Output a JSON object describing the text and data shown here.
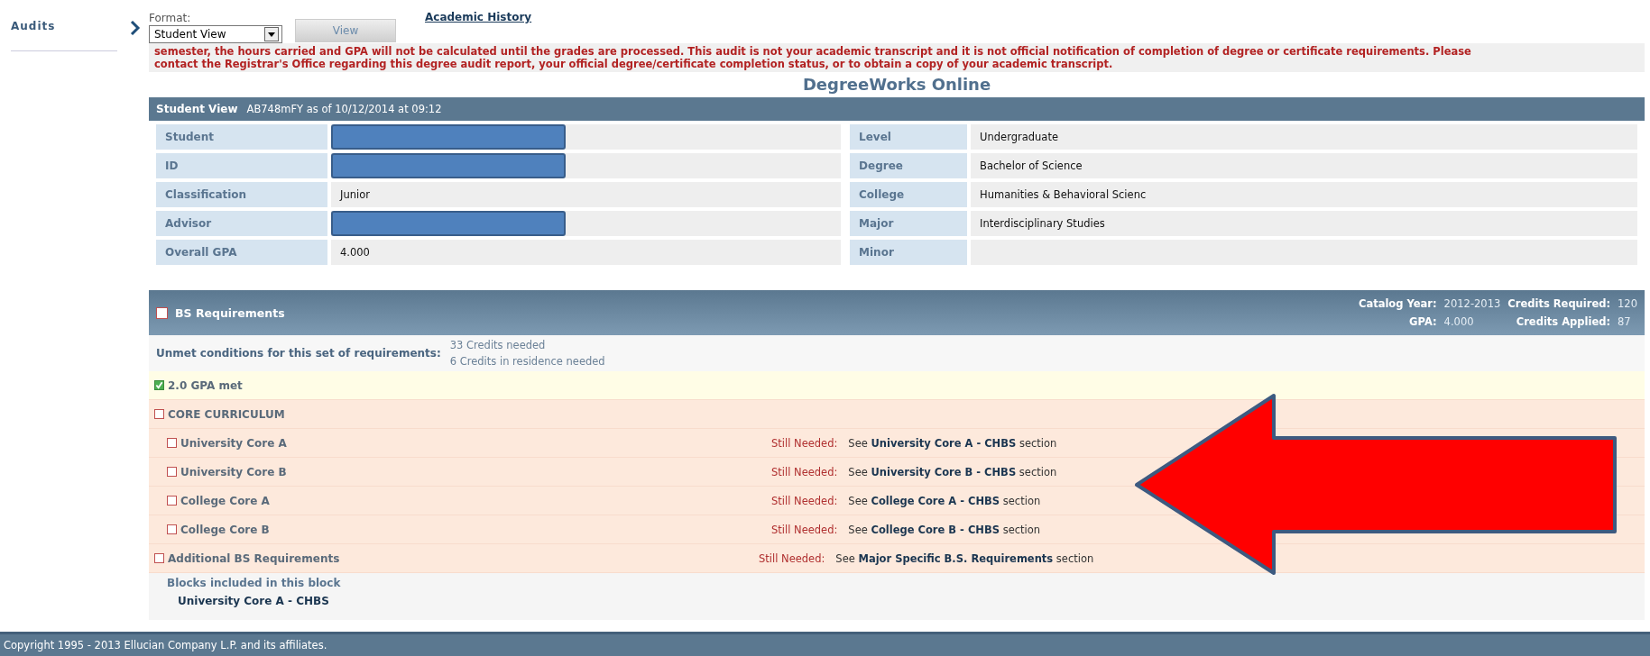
{
  "sidebar": {
    "items": [
      {
        "label": "Audits",
        "selected": true
      }
    ]
  },
  "toolbar": {
    "format_label": "Format:",
    "format_value": "Student View",
    "view_button": "View",
    "link": "Academic History"
  },
  "notice": [
    "semester, the hours carried and GPA will not be calculated until the grades are processed. This audit is not your academic transcript and it is not official notification of completion of degree or certificate requirements. Please",
    "contact the Registrar's Office regarding this degree audit report, your official degree/certificate completion status, or to obtain a copy of your academic transcript."
  ],
  "page_title": "DegreeWorks Online",
  "student_view": {
    "title": "Student View",
    "subtitle": "AB748mFY as of 10/12/2014 at 09:12",
    "left": [
      {
        "label": "Student",
        "redacted": true
      },
      {
        "label": "ID",
        "redacted": true
      },
      {
        "label": "Classification",
        "value": "Junior",
        "redacted": false
      },
      {
        "label": "Advisor",
        "redacted": true
      },
      {
        "label": "Overall GPA",
        "value": "4.000",
        "redacted": false
      }
    ],
    "right": [
      {
        "label": "Level",
        "value": "Undergraduate"
      },
      {
        "label": "Degree",
        "value": "Bachelor of Science"
      },
      {
        "label": "College",
        "value": "Humanities & Behavioral Scienc"
      },
      {
        "label": "Major",
        "value": "Interdisciplinary Studies"
      },
      {
        "label": "Minor"
      }
    ]
  },
  "block": {
    "title": "BS Requirements",
    "met": false,
    "stats": [
      {
        "label": "Catalog Year:",
        "value": "2012-2013"
      },
      {
        "label": "Credits Required:",
        "value": "120"
      },
      {
        "label": "GPA:",
        "value": "4.000"
      },
      {
        "label": "Credits Applied:",
        "value": "87"
      }
    ],
    "unmet_label": "Unmet conditions for this set of requirements:",
    "unmet": [
      "33 Credits needed",
      "6 Credits in residence needed"
    ],
    "rules": [
      {
        "label": "2.0 GPA met",
        "met": true
      },
      {
        "label": "CORE CURRICULUM",
        "met": false,
        "children": [
          {
            "label": "University Core A",
            "met": false,
            "status": "Still Needed:",
            "note": "See **University Core A - CHBS** section"
          },
          {
            "label": "University Core B",
            "met": false,
            "status": "Still Needed:",
            "note": "See **University Core B - CHBS** section"
          },
          {
            "label": "College Core A",
            "met": false,
            "status": "Still Needed:",
            "note": "See **College Core A - CHBS** section"
          },
          {
            "label": "College Core B",
            "met": false,
            "status": "Still Needed:",
            "note": "See **College Core B - CHBS** section"
          }
        ]
      },
      {
        "label": "Additional BS Requirements",
        "met": false,
        "status": "Still Needed:",
        "note": "See **Major Specific B.S. Requirements** section"
      }
    ],
    "included_label": "Blocks included in this block",
    "included": [
      "University Core A - CHBS"
    ]
  },
  "annotation": {
    "kind": "arrow"
  },
  "footer": "Copyright 1995 - 2013 Ellucian Company L.P. and its affiliates."
}
